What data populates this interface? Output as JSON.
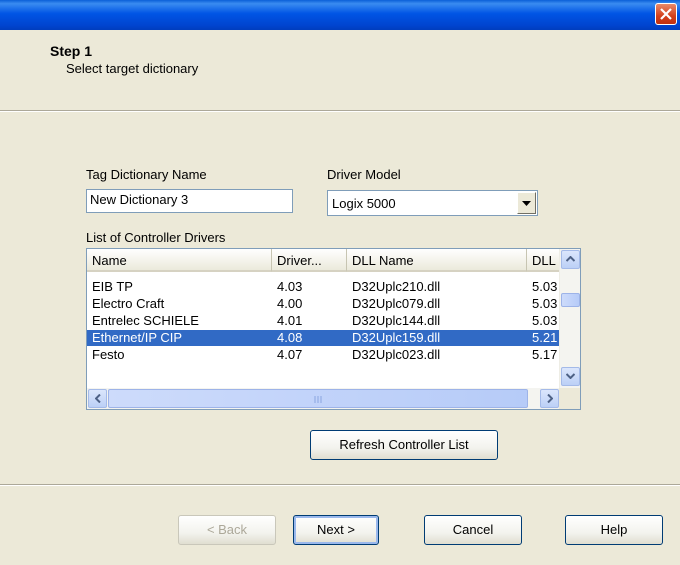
{
  "window": {
    "close_icon": "close-icon"
  },
  "header": {
    "step_title": "Step 1",
    "step_subtitle": "Select target dictionary"
  },
  "form": {
    "tag_dictionary_label": "Tag Dictionary Name",
    "tag_dictionary_value": "New Dictionary 3",
    "driver_model_label": "Driver Model",
    "driver_model_value": "Logix 5000",
    "list_label": "List of Controller Drivers"
  },
  "list": {
    "columns": [
      "Name",
      "Driver...",
      "DLL Name",
      "DLL ..."
    ],
    "rows": [
      {
        "name": "EIB TP",
        "driver": "4.03",
        "dll": "D32Uplc210.dll",
        "dll_ver": "5.03"
      },
      {
        "name": "Electro Craft",
        "driver": "4.00",
        "dll": "D32Uplc079.dll",
        "dll_ver": "5.03"
      },
      {
        "name": "Entrelec SCHIELE",
        "driver": "4.01",
        "dll": "D32Uplc144.dll",
        "dll_ver": "5.03"
      },
      {
        "name": "Ethernet/IP CIP",
        "driver": "4.08",
        "dll": "D32Uplc159.dll",
        "dll_ver": "5.21",
        "selected": true
      },
      {
        "name": "Festo",
        "driver": "4.07",
        "dll": "D32Uplc023.dll",
        "dll_ver": "5.17"
      }
    ]
  },
  "buttons": {
    "refresh": "Refresh Controller List",
    "back": "< Back",
    "next": "Next >",
    "cancel": "Cancel",
    "help": "Help"
  },
  "colors": {
    "selection": "#316ac5",
    "titlebar": "#0055e5",
    "dialog": "#ece9d8"
  }
}
